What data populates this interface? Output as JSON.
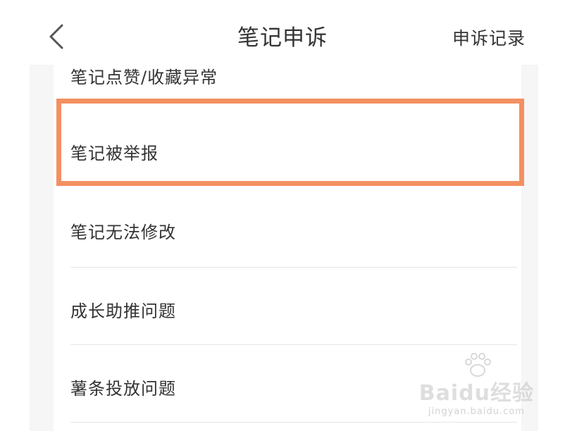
{
  "header": {
    "title": "笔记申诉",
    "records_label": "申诉记录"
  },
  "list": {
    "items": [
      {
        "label": "笔记点赞/收藏异常"
      },
      {
        "label": "笔记被举报"
      },
      {
        "label": "笔记无法修改"
      },
      {
        "label": "成长助推问题"
      },
      {
        "label": "薯条投放问题"
      }
    ],
    "highlighted_index": 1
  },
  "watermark": {
    "logo": "Baidu经验",
    "url": "jingyan.baidu.com"
  },
  "colors": {
    "highlight": "#f39061",
    "badge": "#3dbb3d",
    "panel_bg": "#f6f6f6",
    "text": "#333333",
    "divider": "#e6e6e6"
  }
}
